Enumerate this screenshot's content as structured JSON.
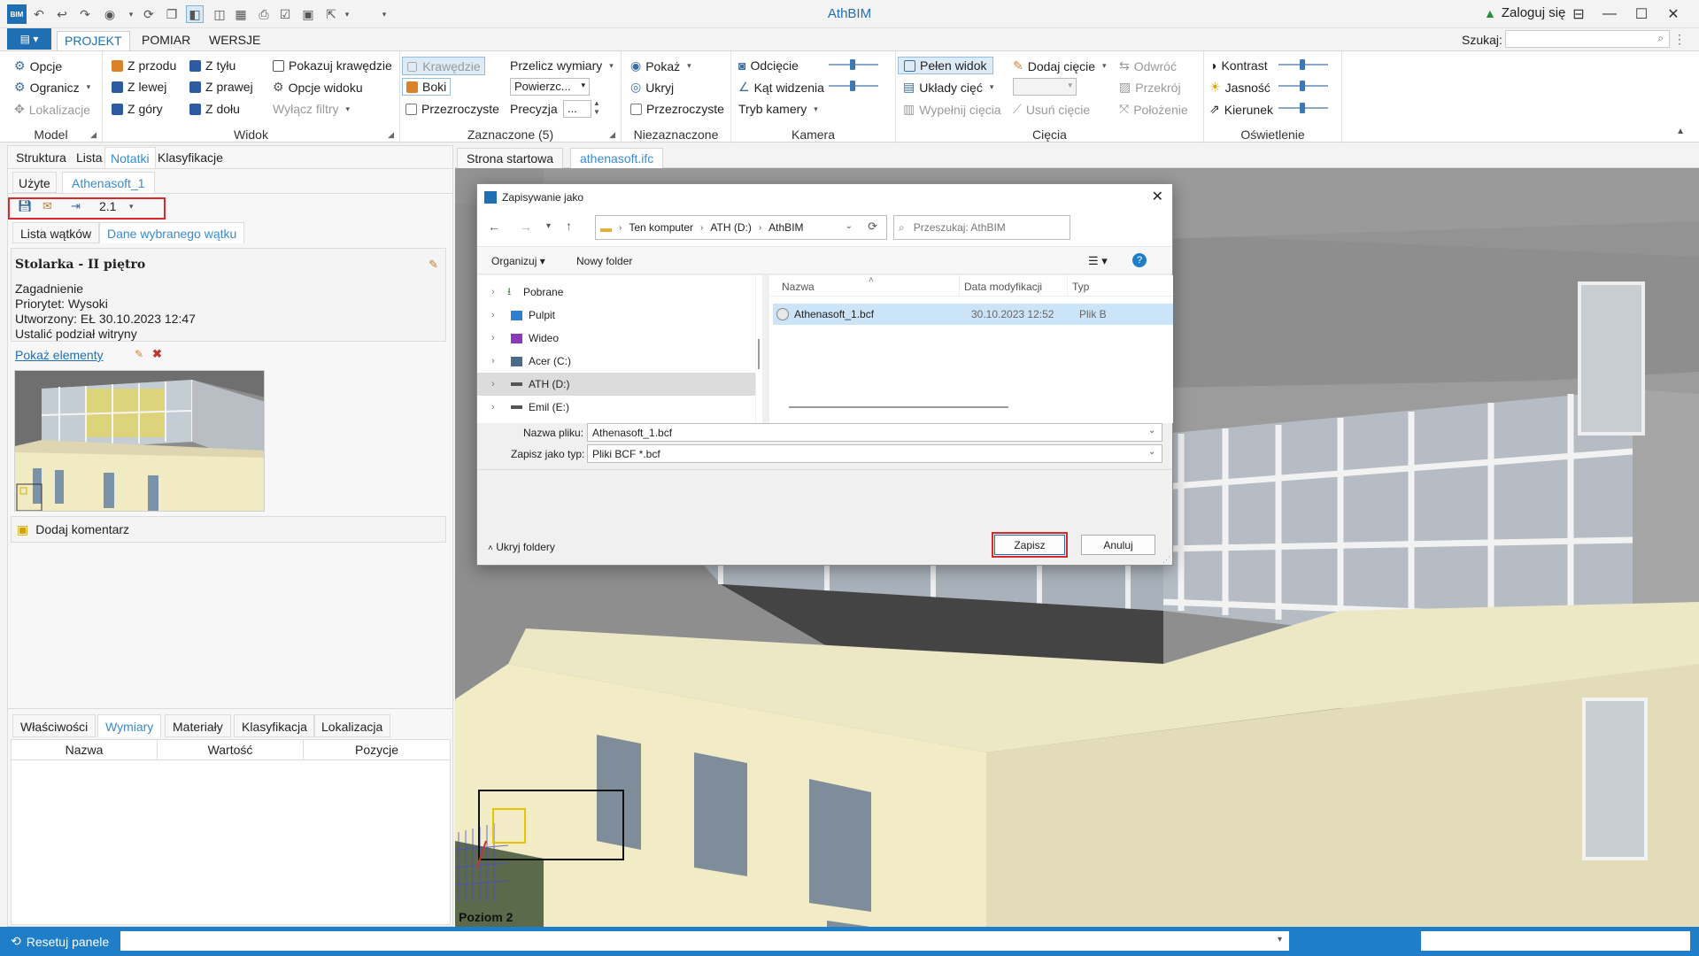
{
  "app": {
    "title": "AthBIM",
    "login": "Zaloguj się"
  },
  "menu": {
    "tabs": [
      "PROJEKT",
      "POMIAR",
      "WERSJE"
    ],
    "search_label": "Szukaj:",
    "search_value": ""
  },
  "ribbon": {
    "model": {
      "label": "Model",
      "items": [
        "Opcje",
        "Ogranicz",
        "Lokalizacje"
      ]
    },
    "widok": {
      "label": "Widok",
      "col1": [
        "Z przodu",
        "Z lewej",
        "Z góry"
      ],
      "col2": [
        "Z tyłu",
        "Z prawej",
        "Z dołu"
      ],
      "col3": [
        "Pokazuj krawędzie",
        "Opcje widoku",
        "Wyłącz filtry"
      ]
    },
    "zaznaczone": {
      "label": "Zaznaczone (5)",
      "col1": [
        "Krawędzie",
        "Boki",
        "Przezroczyste"
      ],
      "przelicz": "Przelicz wymiary",
      "powierzchnia": "Powierzc...",
      "precyzja": "Precyzja",
      "precyzja_value": "..."
    },
    "niezaznaczone": {
      "label": "Niezaznaczone",
      "items": [
        "Pokaż",
        "Ukryj",
        "Przezroczyste"
      ]
    },
    "kamera": {
      "label": "Kamera",
      "items": [
        "Odcięcie",
        "Kąt widzenia",
        "Tryb kamery"
      ]
    },
    "ciecia": {
      "label": "Cięcia",
      "col1": [
        "Pełen widok",
        "Układy cięć",
        "Wypełnij cięcia"
      ],
      "col2": [
        "Dodaj cięcie",
        "",
        "Usuń cięcie"
      ],
      "col3": [
        "Odwróć",
        "Przekrój",
        "Położenie"
      ]
    },
    "oswietlenie": {
      "label": "Oświetlenie",
      "items": [
        "Kontrast",
        "Jasność",
        "Kierunek"
      ]
    }
  },
  "left": {
    "top_tabs": [
      "Struktura",
      "Lista",
      "Notatki",
      "Klasyfikacje"
    ],
    "sub_tabs": [
      "Użyte",
      "Athenasoft_1"
    ],
    "version": "2.1",
    "thread_tabs": [
      "Lista wątków",
      "Dane wybranego wątku"
    ],
    "note": {
      "title": "Stolarka - II piętro",
      "lines": [
        "Zagadnienie",
        "Priorytet: Wysoki",
        "Utworzony: EŁ  30.10.2023 12:47",
        "Ustalić podział witryny"
      ],
      "show_elements": "Pokaż elementy",
      "add_comment": "Dodaj komentarz"
    },
    "prop_tabs": [
      "Właściwości",
      "Wymiary",
      "Materiały",
      "Klasyfikacja",
      "Lokalizacja"
    ],
    "table_headers": [
      "Nazwa",
      "Wartość",
      "Pozycje"
    ]
  },
  "viewtabs": [
    "Strona startowa",
    "athenasoft.ifc"
  ],
  "viewport": {
    "level_label": "Poziom 2"
  },
  "dialog": {
    "title": "Zapisywanie jako",
    "breadcrumb": [
      "Ten komputer",
      "ATH (D:)",
      "AthBIM"
    ],
    "search_placeholder": "Przeszukaj: AthBIM",
    "organize": "Organizuj",
    "new_folder": "Nowy folder",
    "tree": [
      "Pobrane",
      "Pulpit",
      "Wideo",
      "Acer (C:)",
      "ATH (D:)",
      "Emil (E:)"
    ],
    "columns": [
      "Nazwa",
      "Data modyfikacji",
      "Typ"
    ],
    "file": {
      "name": "Athenasoft_1.bcf",
      "date": "30.10.2023 12:52",
      "type": "Plik B"
    },
    "filename_label": "Nazwa pliku:",
    "filename_value": "Athenasoft_1.bcf",
    "filetype_label": "Zapisz jako typ:",
    "filetype_value": "Pliki BCF *.bcf",
    "hide_folders": "Ukryj foldery",
    "save": "Zapisz",
    "cancel": "Anuluj"
  },
  "status": {
    "reset": "Resetuj panele"
  },
  "colors": {
    "accent": "#1f6fb2",
    "highlight_red": "#d52b2b",
    "status_bar": "#1f7ec7"
  }
}
